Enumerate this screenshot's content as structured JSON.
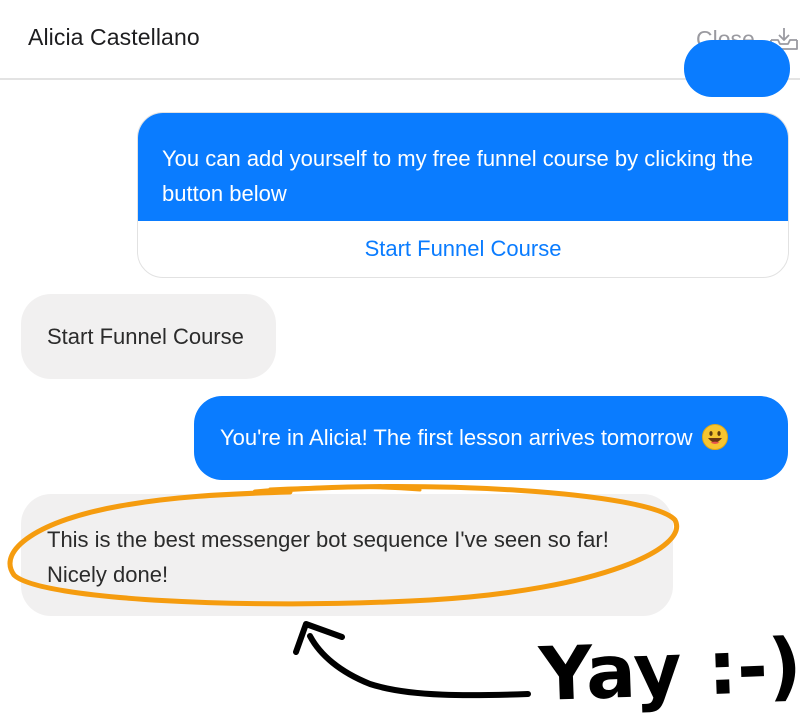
{
  "header": {
    "title": "Alicia Castellano",
    "close_label": "Close",
    "close_icon": "download-tray-icon"
  },
  "messages": [
    {
      "type": "outgoing-card",
      "text": "You can add yourself to my free funnel course by clicking the button below",
      "button_label": "Start Funnel Course"
    },
    {
      "type": "incoming",
      "text": "Start Funnel Course"
    },
    {
      "type": "outgoing",
      "text": "You're in Alicia! The first lesson arrives tomorrow",
      "emoji": "grinning-face-emoji"
    },
    {
      "type": "incoming",
      "line1": "This is the best messenger bot sequence I've seen so far!",
      "line2": "Nicely done!"
    }
  ],
  "annotation": {
    "text": "Yay :-)",
    "ellipse_color": "#f59c0f",
    "ink_color": "#000000"
  },
  "colors": {
    "outgoing_bubble": "#0a7cff",
    "incoming_bubble": "#f1f0f0",
    "button_text": "#0a7cff",
    "header_text": "#1d1d1f",
    "close_text": "#9a9aa0"
  }
}
